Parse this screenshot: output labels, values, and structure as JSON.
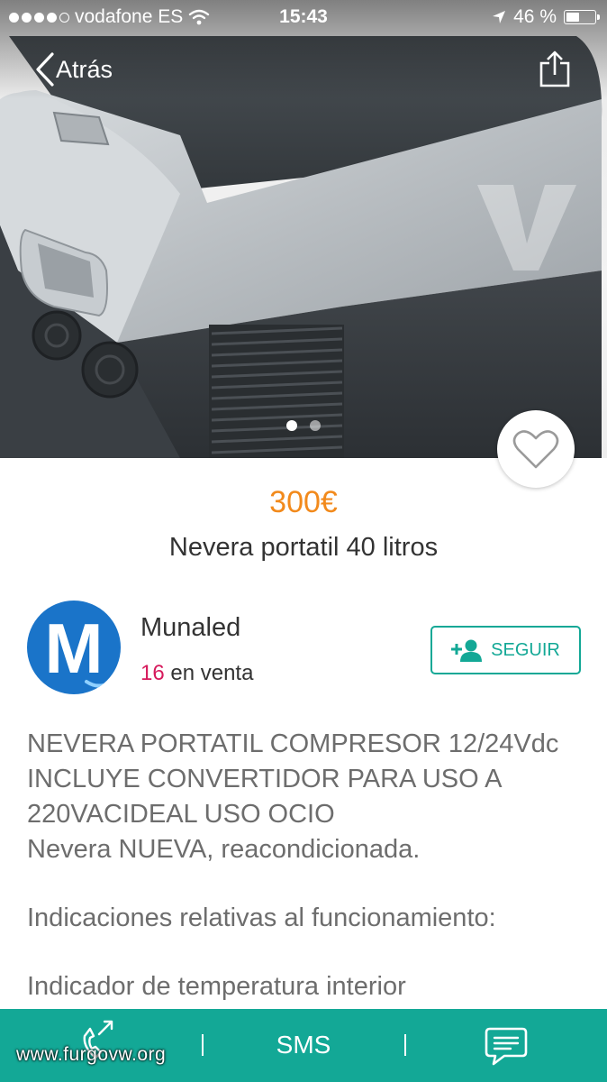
{
  "status_bar": {
    "carrier": "vodafone ES",
    "time": "15:43",
    "battery_text": "46 %",
    "battery_level": 0.46,
    "icons": [
      "signal-dots",
      "wifi-icon",
      "location-arrow-icon",
      "battery-icon"
    ]
  },
  "nav": {
    "back_label": "Atrás",
    "back_icon": "chevron-left-icon",
    "share_icon": "share-icon"
  },
  "gallery": {
    "image": "portable-fridge-photo",
    "page_count": 2,
    "active_page": 1,
    "watermark_logo": "V"
  },
  "favorite_icon": "heart-icon",
  "listing": {
    "price": "300€",
    "title": "Nevera portatil 40 litros"
  },
  "seller": {
    "avatar_letter": "M",
    "name": "Munaled",
    "items_count": "16",
    "items_label": "en venta",
    "follow_label": "SEGUIR",
    "follow_icon": "add-user-icon"
  },
  "description": {
    "line1": "NEVERA PORTATIL COMPRESOR 12/24Vdc",
    "line2": "INCLUYE CONVERTIDOR PARA USO A",
    "line3": "220VACIDEAL USO OCIO",
    "line4": "Nevera NUEVA, reacondicionada.",
    "line5": "Indicaciones relativas al funcionamiento:",
    "line6": "Indicador de temperatura interior"
  },
  "bottom_bar": {
    "call_icon": "phone-icon",
    "sms_label": "SMS",
    "chat_icon": "chat-icon",
    "watermark": "www.furgovw.org"
  },
  "colors": {
    "accent": "#13a896",
    "price": "#f28a1c",
    "count": "#d61a5c",
    "avatar": "#1a74c9"
  }
}
